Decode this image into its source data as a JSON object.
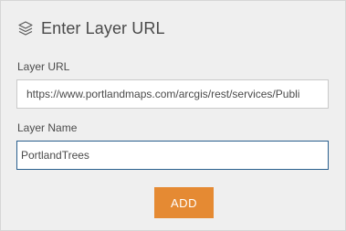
{
  "header": {
    "icon": "layers-icon",
    "title": "Enter Layer URL"
  },
  "form": {
    "url_label": "Layer URL",
    "url_value": "https://www.portlandmaps.com/arcgis/rest/services/Publi",
    "name_label": "Layer Name",
    "name_value": "PortlandTrees"
  },
  "actions": {
    "add_label": "ADD"
  },
  "colors": {
    "panel_background": "#efefef",
    "accent_button": "#e58a33",
    "focus_border": "#2a5f8e"
  }
}
